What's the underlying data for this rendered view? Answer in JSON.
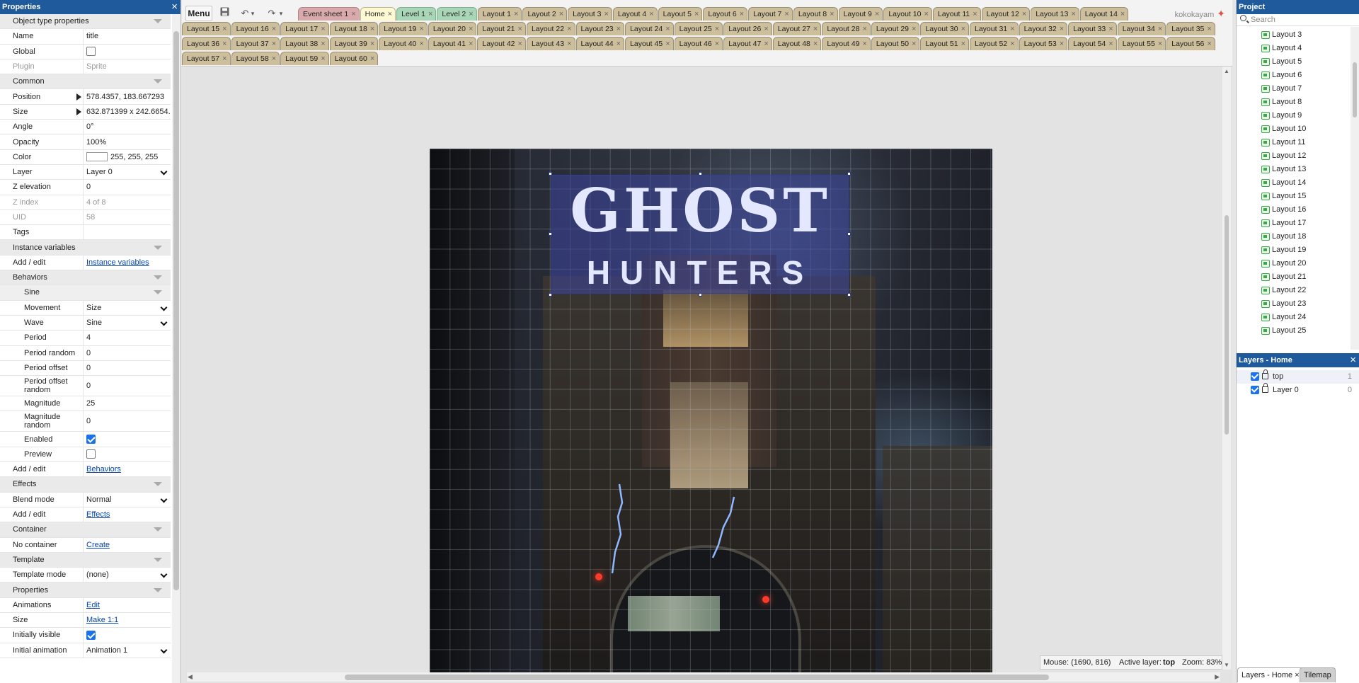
{
  "properties_panel": {
    "title": "Properties",
    "rows": [
      {
        "type": "header",
        "label": "Object type properties"
      },
      {
        "type": "text",
        "label": "Name",
        "value": "title"
      },
      {
        "type": "checkbox",
        "label": "Global",
        "checked": false
      },
      {
        "type": "text",
        "label": "Plugin",
        "value": "Sprite",
        "disabled": true
      },
      {
        "type": "header",
        "label": "Common"
      },
      {
        "type": "text",
        "label": "Position",
        "value": "578.4357, 183.667293",
        "expandable": true
      },
      {
        "type": "text",
        "label": "Size",
        "value": "632.871399 x 242.6654...",
        "expandable": true
      },
      {
        "type": "text",
        "label": "Angle",
        "value": "0°"
      },
      {
        "type": "text",
        "label": "Opacity",
        "value": "100%"
      },
      {
        "type": "color",
        "label": "Color",
        "value": "255, 255, 255",
        "swatch": "#ffffff"
      },
      {
        "type": "select",
        "label": "Layer",
        "value": "Layer 0"
      },
      {
        "type": "text",
        "label": "Z elevation",
        "value": "0"
      },
      {
        "type": "text",
        "label": "Z index",
        "value": "4 of 8",
        "disabled": true
      },
      {
        "type": "text",
        "label": "UID",
        "value": "58",
        "disabled": true
      },
      {
        "type": "text",
        "label": "Tags",
        "value": ""
      },
      {
        "type": "header",
        "label": "Instance variables"
      },
      {
        "type": "link",
        "label": "Add / edit",
        "value": "Instance variables"
      },
      {
        "type": "header",
        "label": "Behaviors"
      },
      {
        "type": "subheader",
        "label": "Sine"
      },
      {
        "type": "select",
        "label": "Movement",
        "value": "Size",
        "sub": true
      },
      {
        "type": "select",
        "label": "Wave",
        "value": "Sine",
        "sub": true
      },
      {
        "type": "text",
        "label": "Period",
        "value": "4",
        "sub": true
      },
      {
        "type": "text",
        "label": "Period random",
        "value": "0",
        "sub": true
      },
      {
        "type": "text",
        "label": "Period offset",
        "value": "0",
        "sub": true
      },
      {
        "type": "text",
        "label": "Period offset random",
        "value": "0",
        "sub": true,
        "tall": true
      },
      {
        "type": "text",
        "label": "Magnitude",
        "value": "25",
        "sub": true
      },
      {
        "type": "text",
        "label": "Magnitude random",
        "value": "0",
        "sub": true,
        "tall": true
      },
      {
        "type": "checkbox",
        "label": "Enabled",
        "checked": true,
        "sub": true
      },
      {
        "type": "checkbox",
        "label": "Preview",
        "checked": false,
        "sub": true
      },
      {
        "type": "link",
        "label": "Add / edit",
        "value": "Behaviors"
      },
      {
        "type": "header",
        "label": "Effects"
      },
      {
        "type": "select",
        "label": "Blend mode",
        "value": "Normal"
      },
      {
        "type": "link",
        "label": "Add / edit",
        "value": "Effects"
      },
      {
        "type": "header",
        "label": "Container"
      },
      {
        "type": "link",
        "label": "No container",
        "value": "Create"
      },
      {
        "type": "header",
        "label": "Template"
      },
      {
        "type": "select",
        "label": "Template mode",
        "value": "(none)"
      },
      {
        "type": "header",
        "label": "Properties"
      },
      {
        "type": "link",
        "label": "Animations",
        "value": "Edit"
      },
      {
        "type": "link",
        "label": "Size",
        "value": "Make 1:1"
      },
      {
        "type": "checkbox",
        "label": "Initially visible",
        "checked": true
      },
      {
        "type": "select",
        "label": "Initial animation",
        "value": "Animation 1"
      }
    ]
  },
  "toolbar": {
    "menu_label": "Menu",
    "save_icon": "floppy-icon",
    "undo_icon": "↶",
    "redo_icon": "↷",
    "play_icon": "▶",
    "dropdown_glyph": "▾",
    "user": "kokokayam"
  },
  "tab_rows": [
    [
      {
        "label": "Event sheet 1",
        "kind": "ev"
      },
      {
        "label": "Home",
        "kind": "home"
      },
      {
        "label": "Level 1",
        "kind": "lvl"
      },
      {
        "label": "Level 2",
        "kind": "lvl"
      },
      {
        "label": "Layout 1"
      },
      {
        "label": "Layout 2"
      },
      {
        "label": "Layout 3"
      },
      {
        "label": "Layout 4"
      },
      {
        "label": "Layout 5"
      },
      {
        "label": "Layout 6"
      },
      {
        "label": "Layout 7"
      },
      {
        "label": "Layout 8"
      },
      {
        "label": "Layout 9"
      },
      {
        "label": "Layout 10"
      },
      {
        "label": "Layout 11"
      },
      {
        "label": "Layout 12"
      },
      {
        "label": "Layout 13"
      },
      {
        "label": "Layout 14"
      }
    ],
    [
      {
        "label": "Layout 15"
      },
      {
        "label": "Layout 16"
      },
      {
        "label": "Layout 17"
      },
      {
        "label": "Layout 18"
      },
      {
        "label": "Layout 19"
      },
      {
        "label": "Layout 20"
      },
      {
        "label": "Layout 21"
      },
      {
        "label": "Layout 22"
      },
      {
        "label": "Layout 23"
      },
      {
        "label": "Layout 24"
      },
      {
        "label": "Layout 25"
      },
      {
        "label": "Layout 26"
      },
      {
        "label": "Layout 27"
      },
      {
        "label": "Layout 28"
      },
      {
        "label": "Layout 29"
      },
      {
        "label": "Layout 30"
      },
      {
        "label": "Layout 31"
      },
      {
        "label": "Layout 32"
      },
      {
        "label": "Layout 33"
      },
      {
        "label": "Layout 34"
      },
      {
        "label": "Layout 35"
      }
    ],
    [
      {
        "label": "Layout 36"
      },
      {
        "label": "Layout 37"
      },
      {
        "label": "Layout 38"
      },
      {
        "label": "Layout 39"
      },
      {
        "label": "Layout 40"
      },
      {
        "label": "Layout 41"
      },
      {
        "label": "Layout 42"
      },
      {
        "label": "Layout 43"
      },
      {
        "label": "Layout 44"
      },
      {
        "label": "Layout 45"
      },
      {
        "label": "Layout 46"
      },
      {
        "label": "Layout 47"
      },
      {
        "label": "Layout 48"
      },
      {
        "label": "Layout 49"
      },
      {
        "label": "Layout 50"
      },
      {
        "label": "Layout 51"
      },
      {
        "label": "Layout 52"
      },
      {
        "label": "Layout 53"
      },
      {
        "label": "Layout 54"
      },
      {
        "label": "Layout 55"
      },
      {
        "label": "Layout 56"
      }
    ],
    [
      {
        "label": "Layout 57"
      },
      {
        "label": "Layout 58"
      },
      {
        "label": "Layout 59"
      },
      {
        "label": "Layout 60"
      }
    ]
  ],
  "canvas": {
    "title_line1": "GHOST",
    "title_line2": "HUNTERS"
  },
  "status_bar": {
    "mouse": "Mouse: (1690, 816)",
    "active_layer_label": "Active layer:",
    "active_layer": "top",
    "zoom": "Zoom: 83%"
  },
  "project_panel": {
    "title": "Project",
    "search_placeholder": "Search",
    "items": [
      "Layout 3",
      "Layout 4",
      "Layout 5",
      "Layout 6",
      "Layout 7",
      "Layout 8",
      "Layout 9",
      "Layout 10",
      "Layout 11",
      "Layout 12",
      "Layout 13",
      "Layout 14",
      "Layout 15",
      "Layout 16",
      "Layout 17",
      "Layout 18",
      "Layout 19",
      "Layout 20",
      "Layout 21",
      "Layout 22",
      "Layout 23",
      "Layout 24",
      "Layout 25"
    ]
  },
  "layers_panel": {
    "title": "Layers - Home",
    "layers": [
      {
        "name": "top",
        "index": "1"
      },
      {
        "name": "Layer 0",
        "index": "0"
      }
    ]
  },
  "bottom_tabs": [
    "Layers - Home",
    "Tilemap"
  ],
  "colors": {
    "accent": "#1e5a9c",
    "tab": "#cdbf9c",
    "event_tab": "#d9a9ab",
    "home_tab": "#fdf9d2",
    "level_tab": "#a8d6b7"
  }
}
